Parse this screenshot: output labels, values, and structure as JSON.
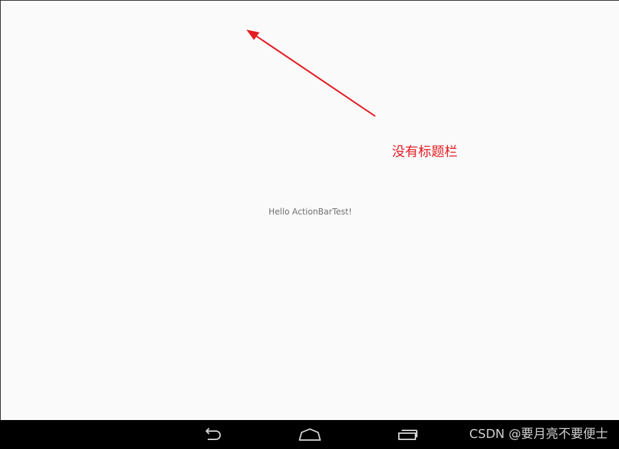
{
  "app": {
    "hello_text": "Hello ActionBarTest!"
  },
  "annotation": {
    "text": "没有标题栏",
    "color": "#e51d23"
  },
  "navbar": {
    "background": "#000000",
    "buttons": [
      {
        "icon": "back-icon"
      },
      {
        "icon": "home-icon"
      },
      {
        "icon": "recent-apps-icon"
      }
    ]
  },
  "watermark": {
    "text": "CSDN @要月亮不要便士"
  }
}
